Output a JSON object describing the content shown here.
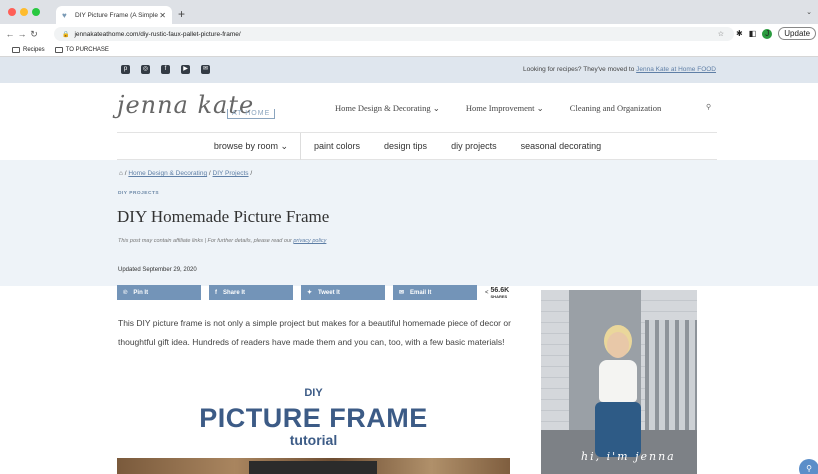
{
  "browser": {
    "tab_title": "DIY Picture Frame (A Simple H",
    "tab_close": "✕",
    "new_tab": "+",
    "tab_menu": "⌄",
    "url": "jennakateathome.com/diy-rustic-faux-pallet-picture-frame/",
    "avatar_letter": "J",
    "update_label": "Update",
    "bookmarks": [
      {
        "label": "Recipes"
      },
      {
        "label": "TO PURCHASE"
      }
    ]
  },
  "site": {
    "topbar_text": "Looking for recipes? They've moved to ",
    "topbar_link": "Jenna Kate at Home FOOD",
    "logo_script": "jenna kate",
    "logo_sub": "AT HOME",
    "main_nav": [
      {
        "label": "Home Design & Decorating ⌄"
      },
      {
        "label": "Home Improvement ⌄"
      },
      {
        "label": "Cleaning and Organization"
      }
    ],
    "category_nav": {
      "browse": "browse by room ⌄",
      "items": [
        {
          "label": "paint colors"
        },
        {
          "label": "design tips"
        },
        {
          "label": "diy projects"
        },
        {
          "label": "seasonal decorating"
        }
      ]
    }
  },
  "article": {
    "breadcrumb_home": "⌂ / ",
    "breadcrumb_1": "Home Design & Decorating",
    "breadcrumb_sep": " / ",
    "breadcrumb_2": "DIY Projects",
    "breadcrumb_end": " /",
    "category": "DIY PROJECTS",
    "title": "DIY Homemade Picture Frame",
    "disclaimer": "This post may contain affiliate links | For further details, please read our ",
    "disclaimer_link": "privacy policy",
    "updated": "Updated September 29, 2020",
    "share_buttons": [
      {
        "icon": "℗",
        "label": "Pin It"
      },
      {
        "icon": "f",
        "label": "Share It"
      },
      {
        "icon": "✦",
        "label": "Tweet It"
      },
      {
        "icon": "✉",
        "label": "Email It"
      }
    ],
    "share_count": "56.6K",
    "share_label": "SHARES",
    "intro": "This DIY picture frame is not only a simple project but makes for a beautiful homemade piece of decor or thoughtful gift idea. Hundreds of readers have made them and you can, too, with a few basic materials!",
    "pin_image": {
      "line1": "DIY",
      "line2": "PICTURE FRAME",
      "line3": "tutorial"
    },
    "sidebar_caption": "hi, i'm jenna"
  }
}
